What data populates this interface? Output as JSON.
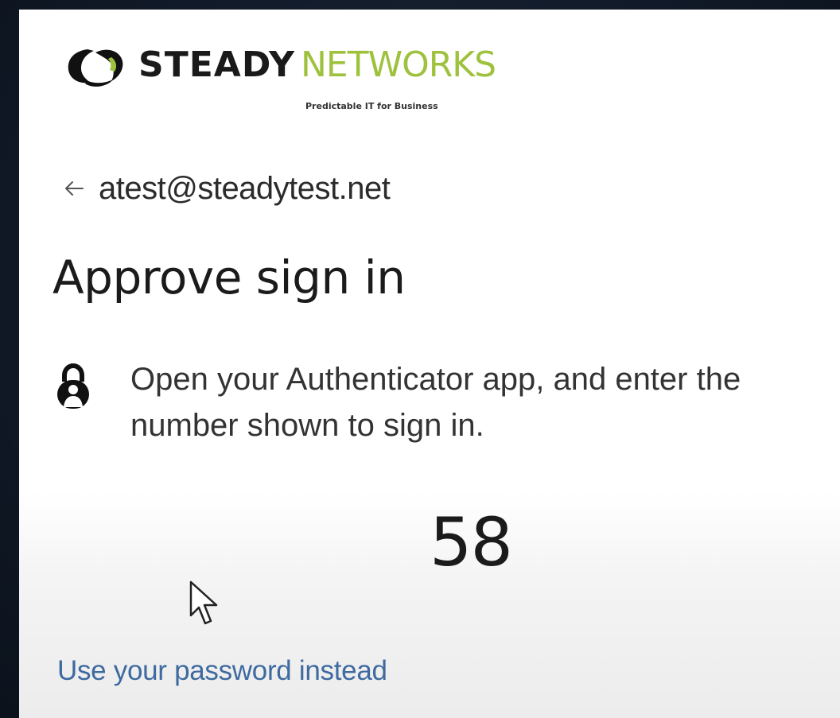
{
  "brand": {
    "name_bold": "STEADY",
    "name_light": "NETWORKS",
    "tagline": "Predictable IT for Business",
    "accent_color": "#9ec23d",
    "mark_icon": "steady-networks-logo-mark"
  },
  "identity": {
    "back_icon": "arrow-left-icon",
    "email": "atest@steadytest.net"
  },
  "title": "Approve sign in",
  "instruction": {
    "icon": "lock-icon",
    "text": "Open your Authenticator app, and enter the number shown to sign in."
  },
  "approval_number": "58",
  "links": {
    "use_password": "Use your password instead",
    "link_color": "#3e6aa0"
  }
}
